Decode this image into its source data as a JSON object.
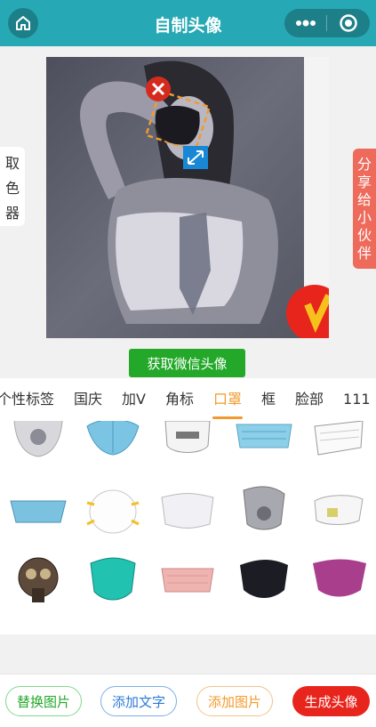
{
  "header": {
    "title": "自制头像",
    "home_icon": "home-icon",
    "more_icon": "more-dots-icon",
    "close_icon": "target-circle-icon"
  },
  "sidebar_left": {
    "chars": [
      "取",
      "色",
      "器"
    ]
  },
  "sidebar_right": {
    "chars": [
      "分",
      "享",
      "给",
      "小",
      "伙",
      "伴"
    ]
  },
  "wechat_button": {
    "label": "获取微信头像"
  },
  "tabs": [
    {
      "label": "个性标签"
    },
    {
      "label": "国庆"
    },
    {
      "label": "加V"
    },
    {
      "label": "角标"
    },
    {
      "label": "口罩",
      "active": true
    },
    {
      "label": "框"
    },
    {
      "label": "脸部"
    },
    {
      "label": "111"
    }
  ],
  "masks": [
    {
      "name": "valve-grey-mask"
    },
    {
      "name": "blue-kn95-mask"
    },
    {
      "name": "white-kn95-mask"
    },
    {
      "name": "blue-surgical-mask"
    },
    {
      "name": "white-fold-mask"
    },
    {
      "name": "blue-flat-mask"
    },
    {
      "name": "white-n95-mask"
    },
    {
      "name": "white-soft-mask"
    },
    {
      "name": "grey-valve-mask"
    },
    {
      "name": "white-valve-mask"
    },
    {
      "name": "gas-mask"
    },
    {
      "name": "teal-n95-mask"
    },
    {
      "name": "pink-mask"
    },
    {
      "name": "black-mask"
    },
    {
      "name": "purple-mask"
    }
  ],
  "footer": {
    "replace_label": "替换图片",
    "add_text_label": "添加文字",
    "add_image_label": "添加图片",
    "generate_label": "生成头像"
  },
  "colors": {
    "header": "#26a9b5",
    "green": "#23a829",
    "accent": "#f29b2d",
    "share": "#ee6a5b",
    "generate": "#e8251d"
  }
}
